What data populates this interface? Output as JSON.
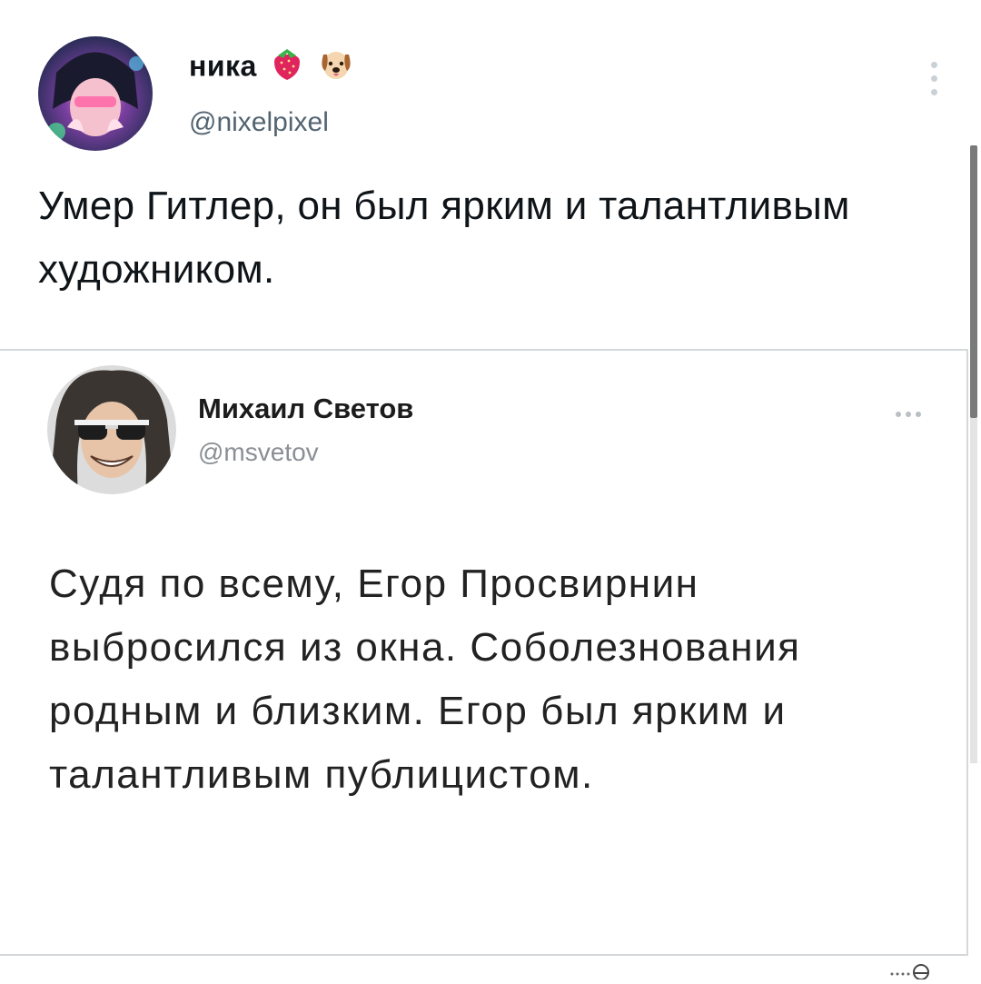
{
  "main_tweet": {
    "display_name": "ника",
    "emojis": [
      "strawberry-emoji",
      "dog-face-emoji"
    ],
    "handle": "@nixelpixel",
    "text": "Умер Гитлер, он был ярким и талантливым художником."
  },
  "quoted_tweet": {
    "display_name": "Михаил Светов",
    "handle": "@msvetov",
    "text": "Судя по всему, Егор Просвирнин выбросился из окна. Соболезнования родным и близким. Егор был ярким и талантливым публицистом."
  },
  "icons": {
    "main_menu": "more-vertical-icon",
    "quote_menu": "more-horizontal-icon"
  },
  "colors": {
    "text": "#0f1419",
    "secondary_text": "#536471",
    "border": "#d4d8db"
  }
}
